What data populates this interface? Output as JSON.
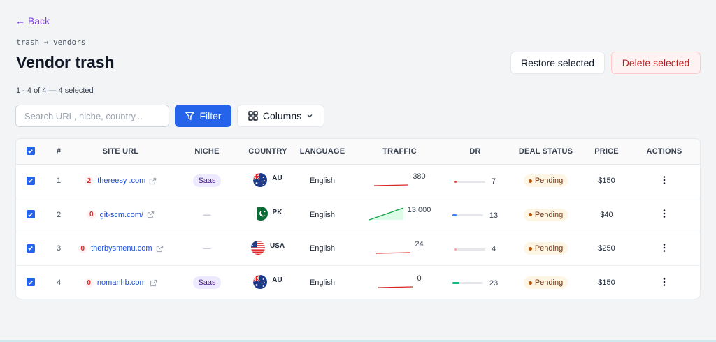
{
  "nav": {
    "back_label": "← Back",
    "breadcrumb": "trash → vendors"
  },
  "header": {
    "title": "Vendor trash",
    "count_text": "1 - 4 of 4 — 4 selected",
    "restore_label": "Restore selected",
    "delete_label": "Delete selected"
  },
  "toolbar": {
    "search_placeholder": "Search URL, niche, country...",
    "filter_label": "Filter",
    "columns_label": "Columns"
  },
  "table": {
    "columns": [
      "#",
      "SITE URL",
      "NICHE",
      "COUNTRY",
      "LANGUAGE",
      "TRAFFIC",
      "DR",
      "DEAL STATUS",
      "PRICE",
      "ACTIONS"
    ],
    "rows": [
      {
        "index": "1",
        "badge": "2",
        "url": "thereesy .com",
        "niche": "Saas",
        "flag": "au",
        "country": "AU",
        "language": "English",
        "traffic": "380",
        "traffic_trend": "flat",
        "dr": "7",
        "dr_level": 0.07,
        "dr_color": "#ef4444",
        "status": "Pending",
        "price": "$150"
      },
      {
        "index": "2",
        "badge": "0",
        "url": "git-scm.com/",
        "niche": "—",
        "flag": "pk",
        "country": "PK",
        "language": "English",
        "traffic": "13,000",
        "traffic_trend": "up",
        "dr": "13",
        "dr_level": 0.13,
        "dr_color": "#3b82f6",
        "status": "Pending",
        "price": "$40"
      },
      {
        "index": "3",
        "badge": "0",
        "url": "therbysmenu.com",
        "niche": "—",
        "flag": "us",
        "country": "USA",
        "language": "English",
        "traffic": "24",
        "traffic_trend": "flat",
        "dr": "4",
        "dr_level": 0.04,
        "dr_color": "#fca5a5",
        "status": "Pending",
        "price": "$250"
      },
      {
        "index": "4",
        "badge": "0",
        "url": "nomanhb.com",
        "niche": "Saas",
        "flag": "au",
        "country": "AU",
        "language": "English",
        "traffic": "0",
        "traffic_trend": "flat",
        "dr": "23",
        "dr_level": 0.23,
        "dr_color": "#10b981",
        "status": "Pending",
        "price": "$150"
      }
    ]
  },
  "colors": {
    "accent": "#2563eb",
    "back_link": "#7c3aed",
    "danger": "#b91c1c",
    "pending": "#b45309"
  }
}
